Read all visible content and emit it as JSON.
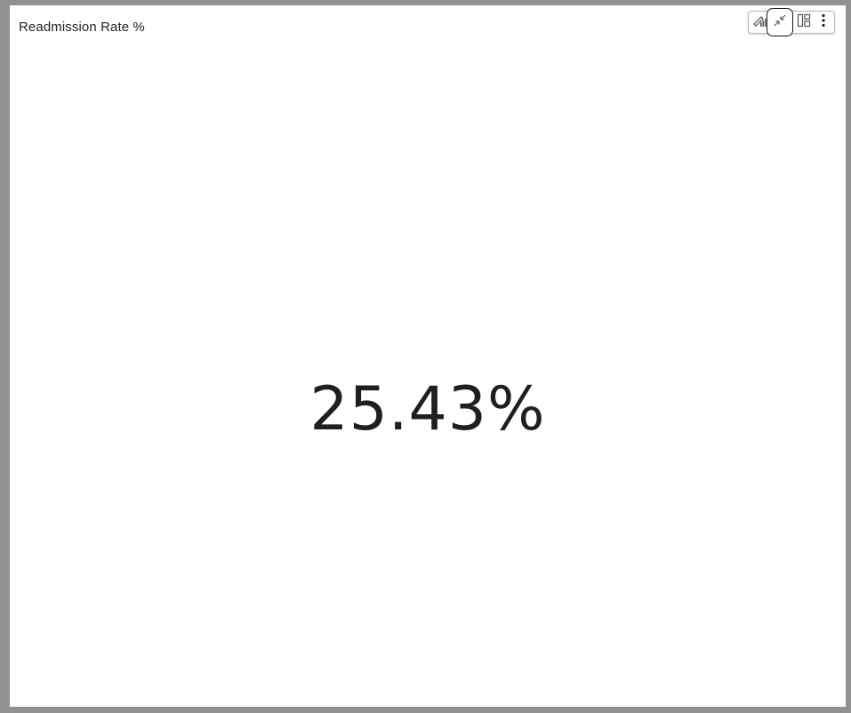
{
  "visual": {
    "title": "Readmission Rate %",
    "kpi_value": "25.43%"
  },
  "toolbar": {
    "icons": [
      "visual-analytics-icon",
      "collapse-icon",
      "layout-icon",
      "more-options-icon"
    ]
  },
  "colors": {
    "background": "#919191",
    "card": "#ffffff",
    "text": "#1f1f1f"
  }
}
